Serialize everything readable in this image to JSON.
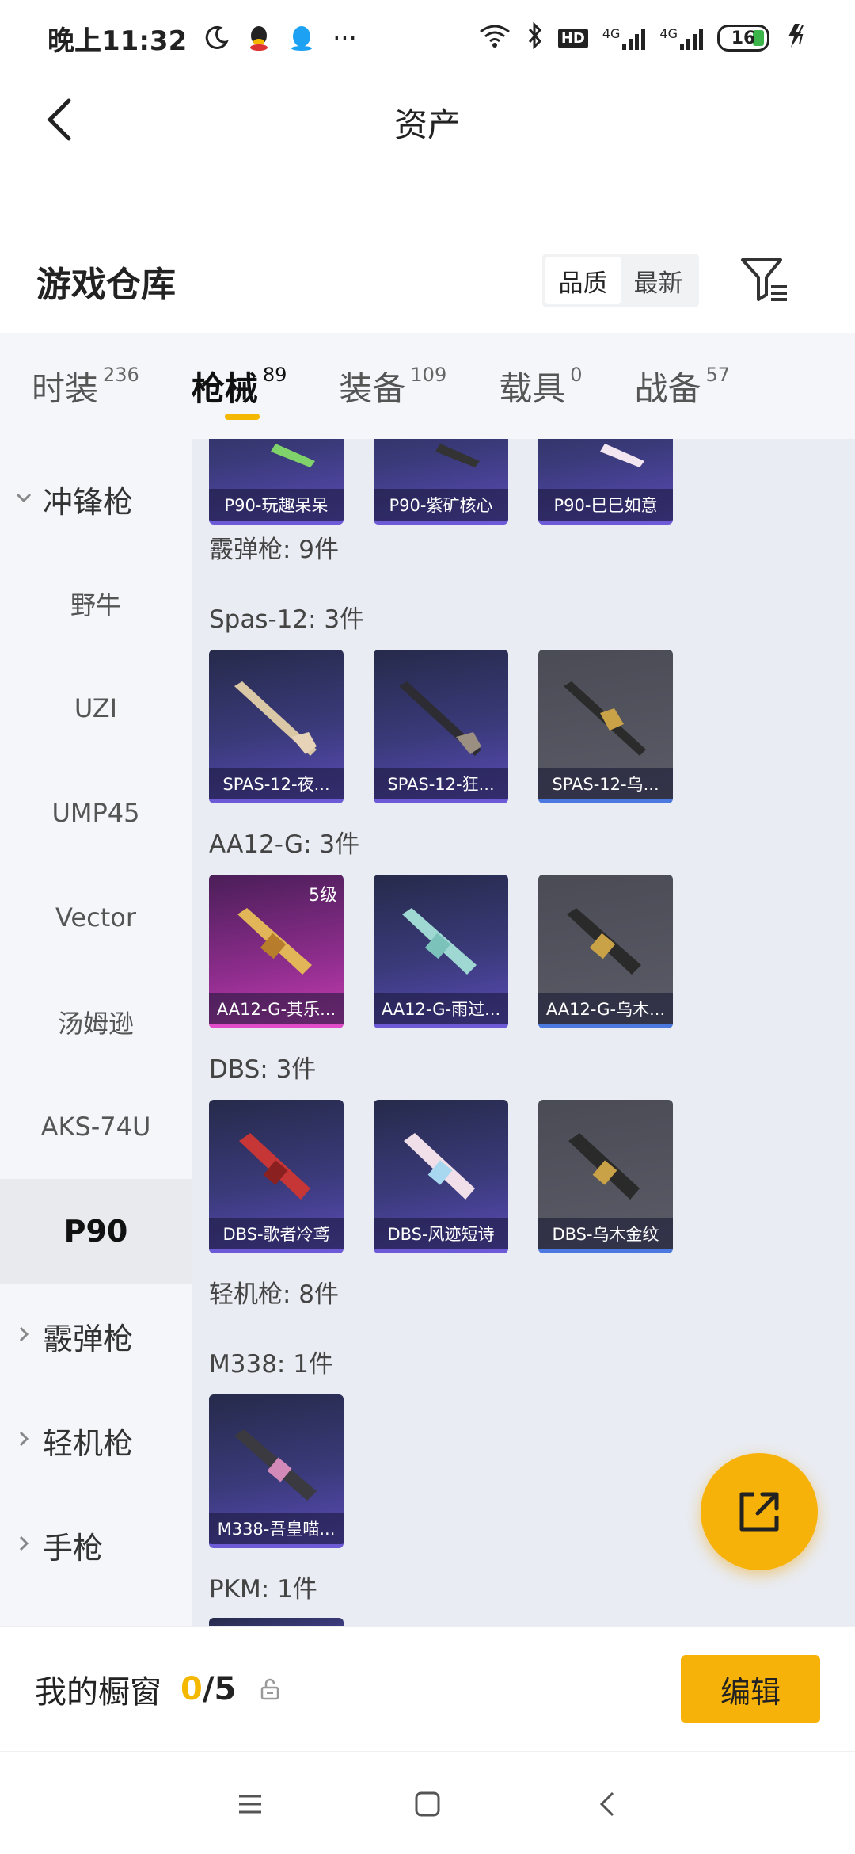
{
  "status_bar": {
    "time": "晚上11:32",
    "network_1": "4G",
    "network_2": "4G",
    "battery": "16",
    "more": "···",
    "hd": "HD"
  },
  "header": {
    "title": "资产"
  },
  "section": {
    "title": "游戏仓库",
    "sort_options": [
      "品质",
      "最新"
    ]
  },
  "tabs": [
    {
      "label": "时装",
      "count": "236"
    },
    {
      "label": "枪械",
      "count": "89"
    },
    {
      "label": "装备",
      "count": "109"
    },
    {
      "label": "载具",
      "count": "0"
    },
    {
      "label": "战备",
      "count": "57"
    }
  ],
  "sidebar": {
    "groups": [
      {
        "label": "冲锋枪",
        "expanded": true
      },
      {
        "label": "霰弹枪",
        "expanded": false
      },
      {
        "label": "轻机枪",
        "expanded": false
      },
      {
        "label": "手枪",
        "expanded": false
      }
    ],
    "sub_items": [
      "野牛",
      "UZI",
      "UMP45",
      "Vector",
      "汤姆逊",
      "AKS-74U",
      "P90"
    ],
    "active": "P90"
  },
  "content": {
    "top_cards": [
      "P90-玩趣呆呆",
      "P90-紫矿核心",
      "P90-巳巳如意"
    ],
    "shotgun_group": "霰弹枪: 9件",
    "spas_heading": "Spas-12: 3件",
    "spas_cards": [
      "SPAS-12-夜...",
      "SPAS-12-狂...",
      "SPAS-12-乌..."
    ],
    "aa12_heading": "AA12-G: 3件",
    "aa12_cards": [
      "AA12-G-其乐...",
      "AA12-G-雨过...",
      "AA12-G-乌木..."
    ],
    "aa12_level": "5级",
    "dbs_heading": "DBS: 3件",
    "dbs_cards": [
      "DBS-歌者冷鸢",
      "DBS-风迹短诗",
      "DBS-乌木金纹"
    ],
    "lmg_group": "轻机枪: 8件",
    "m338_heading": "M338: 1件",
    "m338_cards": [
      "M338-吾皇喵..."
    ],
    "pkm_heading": "PKM: 1件"
  },
  "bottom_bar": {
    "label": "我的橱窗",
    "count_current": "0",
    "count_sep": "/5",
    "edit_label": "编辑"
  },
  "colors": {
    "accent": "#f5b800",
    "fab": "#f7b20a",
    "card_purple": "#3a3a7a",
    "card_gray": "#5a5b66",
    "card_pink": "#8e2d8d"
  },
  "icons": [
    "moon-icon",
    "qq-icon",
    "wifi-icon",
    "bluetooth-icon",
    "signal-icon",
    "battery-icon",
    "charging-icon",
    "back-arrow-icon",
    "filter-icon",
    "share-icon",
    "lock-icon",
    "menu-icon",
    "home-icon",
    "nav-back-icon"
  ]
}
